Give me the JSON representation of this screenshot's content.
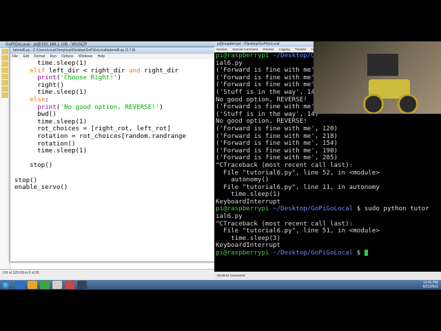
{
  "file_manager": {
    "title": "GoPiGoLocal - pi@192.168.1.108 - WinSCP",
    "status": "0 B of 320 KB in 0 of 35"
  },
  "editor": {
    "title": "tutorial6.py - C:\\Users\\Local\\Temp\\scp\\Desktop\\GoPiGoLocal\\tutorial6.py (2.7.8)",
    "menu": [
      "File",
      "Edit",
      "Format",
      "Run",
      "Options",
      "Windows",
      "Help"
    ],
    "code_lines": [
      "      time.sleep(1)",
      "    elif left_dir < right_dir and right_dir",
      "      print('Choose Right!')",
      "      right()",
      "      time.sleep(1)",
      "    else:",
      "      print('No good option, REVERSE!')",
      "      bwd()",
      "      time.sleep(1)",
      "      rot_choices = [right_rot, left_rot]",
      "      rotation = rot_choices[random.randrange",
      "      rotation()",
      "      time.sleep(1)",
      "",
      "    stop()",
      "",
      "stop()",
      "enable_servo()"
    ]
  },
  "terminal": {
    "title": "pi@raspberrypi: ~/Desktop/GoPiGoLocal",
    "menu": [
      "Session",
      "Special Command",
      "Window",
      "Logging",
      "Transfer",
      "Help"
    ],
    "prompt_user": "pi@raspberrypi",
    "prompt_path": "~/Desktop/GoPiGoLocal",
    "lines": [
      "pi@raspberrypi ~/Desktop/GoPiGoLocal $ sudo python tutor",
      "ial6.py",
      "('Forward is fine with me', 120)",
      "('Forward is fine with me', 218)",
      "('Forward is fine with me', 154)",
      "('Stuff is in the way', 14)",
      "No good option, REVERSE!",
      "('Forward is fine with me', 156)",
      "('Stuff is in the way', 14)",
      "No good option, REVERSE!",
      "('Forward is fine with me', 120)",
      "('Forward is fine with me', 218)",
      "('Forward is fine with me', 154)",
      "('Forward is fine with me', 190)",
      "('Forward is fine with me', 285)",
      "^CTraceback (most recent call last):",
      "  File \"tutorial6.py\", line 52, in <module>",
      "    autonomy()",
      "  File \"tutorial6.py\", line 11, in autonomy",
      "    time.sleep(1)",
      "KeyboardInterrupt",
      "pi@raspberrypi ~/Desktop/GoPiGoLocal $ sudo python tutor",
      "ial6.py",
      "^CTraceback (most recent call last):",
      "  File \"tutorial6.py\", line 51, in <module>",
      "    time.sleep(3)",
      "KeyboardInterrupt",
      "pi@raspberrypi ~/Desktop/GoPiGoLocal $ "
    ],
    "status": "00:09:54 Connected"
  },
  "taskbar": {
    "time": "12:41 PM",
    "date": "6/21/2015"
  }
}
